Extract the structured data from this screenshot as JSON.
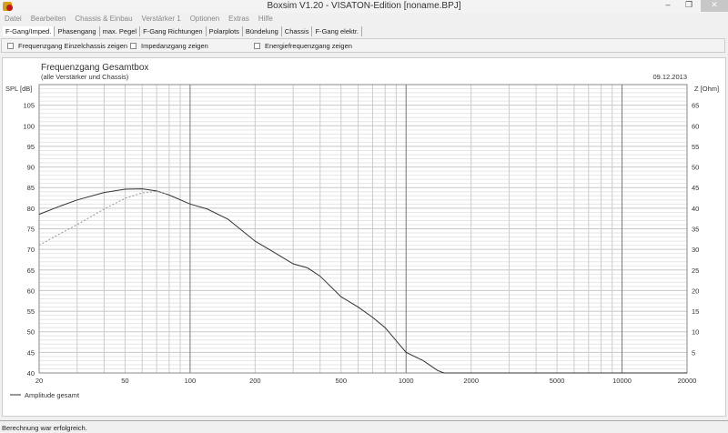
{
  "window": {
    "title": "Boxsim V1.20 - VISATON-Edition [noname.BPJ]",
    "minimize": "–",
    "maximize": "❐",
    "close": "✕"
  },
  "menu": [
    "Datei",
    "Bearbeiten",
    "Chassis & Einbau",
    "Verstärker 1",
    "Optionen",
    "Extras",
    "Hilfe"
  ],
  "tabs": [
    "F-Gang/Imped.",
    "Phasengang",
    "max. Pegel",
    "F-Gang Richtungen",
    "Polarplots",
    "Bündelung",
    "Chassis",
    "F-Gang elektr."
  ],
  "options": [
    {
      "label": "Frequenzgang Einzelchassis zeigen",
      "checked": false
    },
    {
      "label": "Impedanzgang zeigen",
      "checked": false
    },
    {
      "label": "Energiefrequenzgang zeigen",
      "checked": false
    }
  ],
  "status": "Berechnung war erfolgreich.",
  "chart_data": {
    "type": "line",
    "title": "Frequenzgang Gesamtbox",
    "subtitle": "(alle Verstärker und Chassis)",
    "date": "09.12.2013",
    "ylabel": "SPL [dB]",
    "y2label": "Z [Ohm]",
    "xscale": "log",
    "xlim": [
      20,
      20000
    ],
    "ylim": [
      40,
      110
    ],
    "y2lim": [
      0,
      70
    ],
    "xticks": [
      20,
      50,
      100,
      200,
      500,
      1000,
      2000,
      5000,
      10000,
      20000
    ],
    "yticks": [
      40,
      45,
      50,
      55,
      60,
      65,
      70,
      75,
      80,
      85,
      90,
      95,
      100,
      105
    ],
    "y2ticks": [
      5,
      10,
      15,
      20,
      25,
      30,
      35,
      40,
      45,
      50,
      55,
      60,
      65
    ],
    "grid": true,
    "legend": "bottom-left",
    "series": [
      {
        "name": "Amplitude gesamt",
        "style": "solid",
        "color": "#333333",
        "x": [
          20,
          25,
          30,
          40,
          50,
          60,
          70,
          80,
          100,
          120,
          150,
          200,
          250,
          300,
          350,
          400,
          500,
          600,
          700,
          800,
          1000,
          1200,
          1400,
          1500,
          2000,
          5000,
          20000
        ],
        "y": [
          78.5,
          80.5,
          82,
          83.8,
          84.6,
          84.7,
          84.2,
          83.2,
          81,
          79.8,
          77.3,
          72,
          69,
          66.5,
          65.5,
          63.5,
          58.5,
          56,
          53.5,
          51,
          45,
          43,
          40.6,
          40,
          40,
          40,
          40
        ]
      },
      {
        "name": "",
        "style": "dashed",
        "color": "#999999",
        "x": [
          20,
          25,
          30,
          40,
          50,
          60,
          70,
          80
        ],
        "y": [
          71,
          73.8,
          76,
          79.8,
          82.4,
          83.7,
          84.1,
          83.3
        ]
      }
    ]
  }
}
